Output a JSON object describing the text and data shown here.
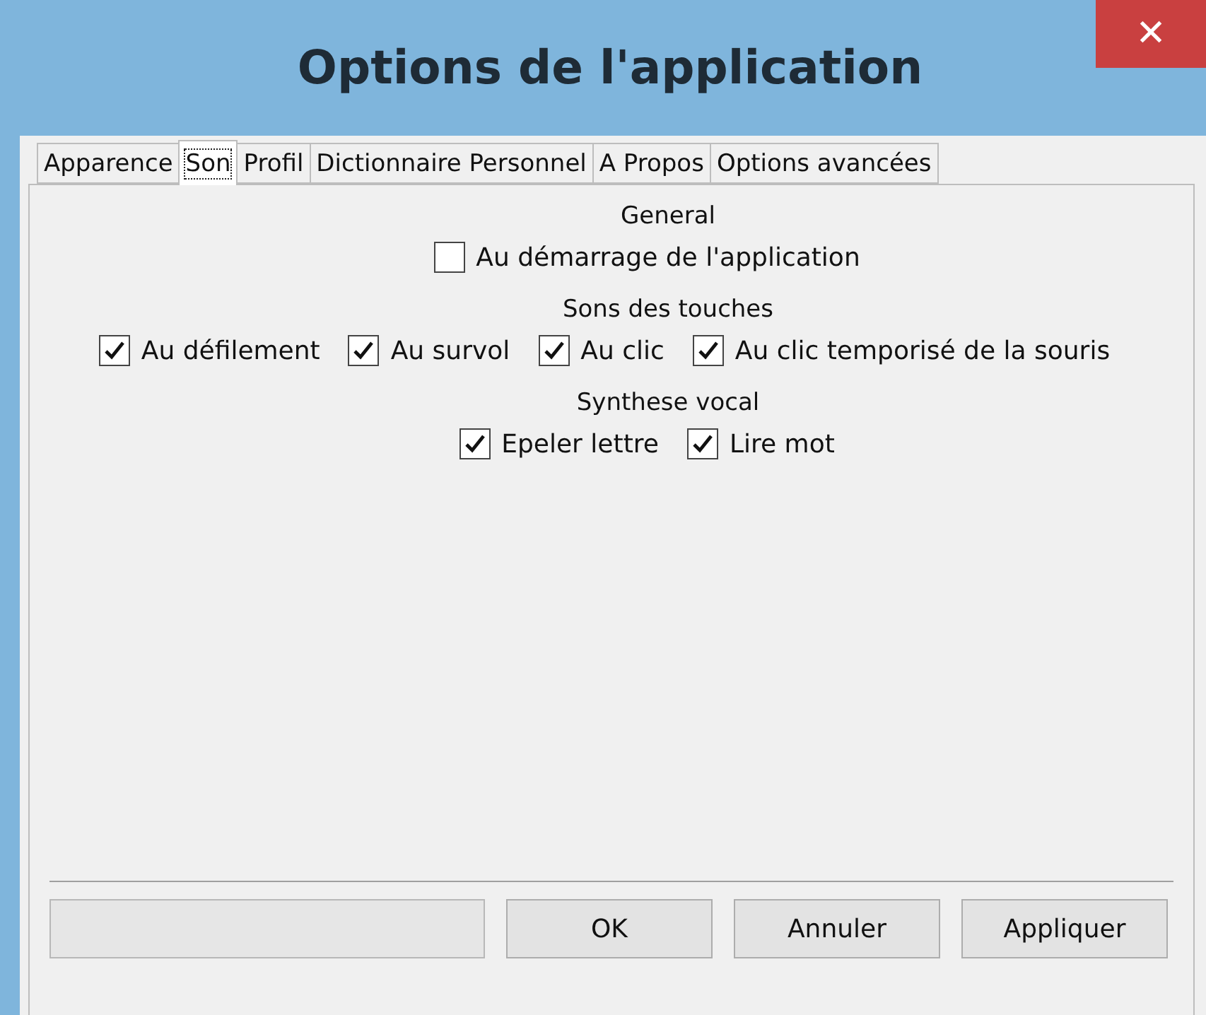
{
  "window": {
    "title": "Options de l'application",
    "close": "✕"
  },
  "tabs": [
    {
      "label": "Apparence",
      "selected": false
    },
    {
      "label": "Son",
      "selected": true
    },
    {
      "label": "Profil",
      "selected": false
    },
    {
      "label": "Dictionnaire Personnel",
      "selected": false
    },
    {
      "label": "A Propos",
      "selected": false
    },
    {
      "label": "Options avancées",
      "selected": false
    }
  ],
  "sections": [
    {
      "heading": "General",
      "options": [
        {
          "label": "Au démarrage de l'application",
          "checked": false
        }
      ]
    },
    {
      "heading": "Sons des touches",
      "options": [
        {
          "label": "Au défilement",
          "checked": true
        },
        {
          "label": "Au survol",
          "checked": true
        },
        {
          "label": "Au clic",
          "checked": true
        },
        {
          "label": "Au clic temporisé de la souris",
          "checked": true
        }
      ]
    },
    {
      "heading": "Synthese vocal",
      "options": [
        {
          "label": "Epeler lettre",
          "checked": true
        },
        {
          "label": "Lire mot",
          "checked": true
        }
      ]
    }
  ],
  "buttons": [
    "OK",
    "Annuler",
    "Appliquer"
  ]
}
